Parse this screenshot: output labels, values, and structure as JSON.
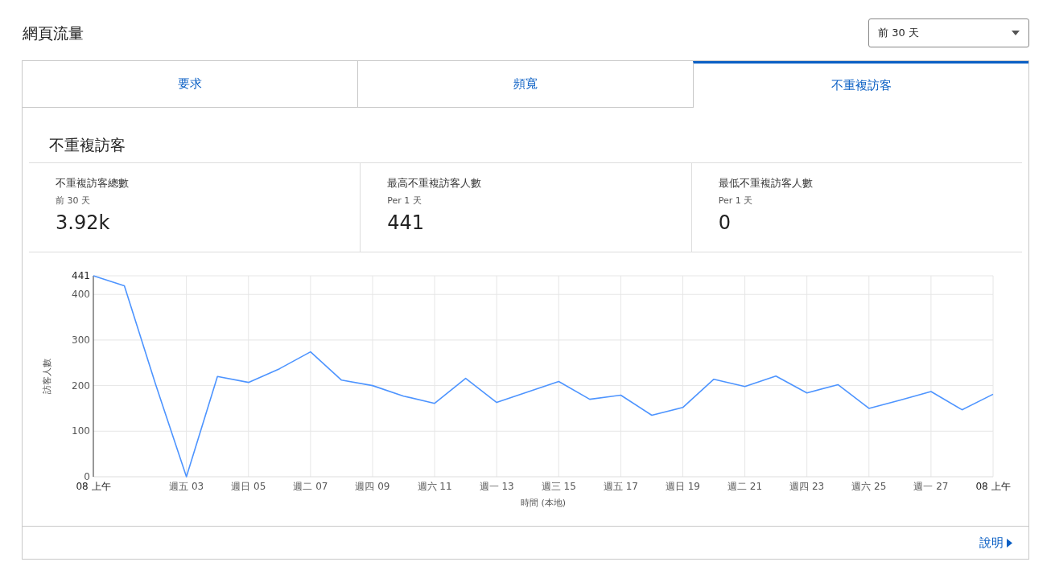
{
  "title": "網頁流量",
  "range_select": {
    "value": "前 30 天"
  },
  "tabs": [
    {
      "label": "要求",
      "selected": false
    },
    {
      "label": "頻寬",
      "selected": false
    },
    {
      "label": "不重複訪客",
      "selected": true
    }
  ],
  "section_title": "不重複訪客",
  "stats": [
    {
      "label": "不重複訪客總數",
      "sub": "前 30 天",
      "value": "3.92k"
    },
    {
      "label": "最高不重複訪客人數",
      "sub": "Per 1 天",
      "value": "441"
    },
    {
      "label": "最低不重複訪客人數",
      "sub": "Per 1 天",
      "value": "0"
    }
  ],
  "chart": {
    "chart_data": {
      "type": "line",
      "xlabel": "時間 (本地)",
      "ylabel": "訪客人數",
      "categories": [
        "08 上午",
        null,
        null,
        "週五 03",
        null,
        "週日 05",
        null,
        "週二 07",
        null,
        "週四 09",
        null,
        "週六 11",
        null,
        "週一 13",
        null,
        "週三 15",
        null,
        "週五 17",
        null,
        "週日 19",
        null,
        "週二 21",
        null,
        "週四 23",
        null,
        "週六 25",
        null,
        "週一 27",
        null,
        "08 上午"
      ],
      "series": [
        {
          "color": "#4d94ff",
          "values": [
            441,
            419,
            204,
            0,
            220,
            207,
            237,
            274,
            212,
            200,
            177,
            161,
            216,
            163,
            186,
            209,
            170,
            179,
            135,
            152,
            214,
            198,
            221,
            184,
            202,
            150,
            168,
            187,
            147,
            181
          ]
        }
      ],
      "ylim": [
        0,
        441
      ],
      "grid": true,
      "yticks": [
        0,
        100,
        200,
        300,
        400,
        441
      ]
    }
  },
  "help_link": "說明"
}
